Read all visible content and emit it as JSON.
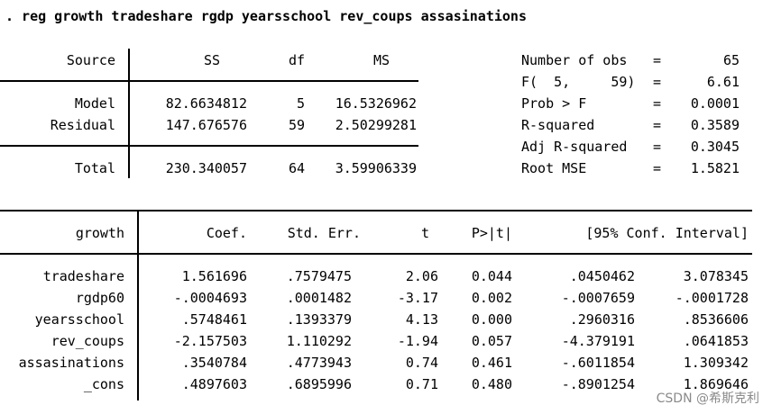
{
  "command": ". reg growth tradeshare rgdp yearsschool rev_coups assasinations",
  "anova": {
    "headers": {
      "source": "Source",
      "ss": "SS",
      "df": "df",
      "ms": "MS"
    },
    "rows": [
      {
        "source": "Model",
        "ss": "82.6634812",
        "df": "5",
        "ms": "16.5326962"
      },
      {
        "source": "Residual",
        "ss": "147.676576",
        "df": "59",
        "ms": "2.50299281"
      },
      {
        "source": "Total",
        "ss": "230.340057",
        "df": "64",
        "ms": "3.59906339"
      }
    ]
  },
  "stats": [
    {
      "label": "Number of obs",
      "eq": "=",
      "value": "65"
    },
    {
      "label": "F(  5,     59)",
      "eq": "=",
      "value": "6.61"
    },
    {
      "label": "Prob > F",
      "eq": "=",
      "value": "0.0001"
    },
    {
      "label": "R-squared",
      "eq": "=",
      "value": "0.3589"
    },
    {
      "label": "Adj R-squared",
      "eq": "=",
      "value": "0.3045"
    },
    {
      "label": "Root MSE",
      "eq": "=",
      "value": "1.5821"
    }
  ],
  "coef": {
    "headers": {
      "var": "growth",
      "coef": "Coef.",
      "se": "Std. Err.",
      "t": "t",
      "p": "P>|t|",
      "ci": "[95% Conf. Interval]"
    },
    "rows": [
      {
        "var": "tradeshare",
        "coef": "1.561696",
        "se": ".7579475",
        "t": "2.06",
        "p": "0.044",
        "lo": ".0450462",
        "hi": "3.078345"
      },
      {
        "var": "rgdp60",
        "coef": "-.0004693",
        "se": ".0001482",
        "t": "-3.17",
        "p": "0.002",
        "lo": "-.0007659",
        "hi": "-.0001728"
      },
      {
        "var": "yearsschool",
        "coef": ".5748461",
        "se": ".1393379",
        "t": "4.13",
        "p": "0.000",
        "lo": ".2960316",
        "hi": ".8536606"
      },
      {
        "var": "rev_coups",
        "coef": "-2.157503",
        "se": "1.110292",
        "t": "-1.94",
        "p": "0.057",
        "lo": "-4.379191",
        "hi": ".0641853"
      },
      {
        "var": "assasinations",
        "coef": ".3540784",
        "se": ".4773943",
        "t": "0.74",
        "p": "0.461",
        "lo": "-.6011854",
        "hi": "1.309342"
      },
      {
        "var": "_cons",
        "coef": ".4897603",
        "se": ".6895996",
        "t": "0.71",
        "p": "0.480",
        "lo": "-.8901254",
        "hi": "1.869646"
      }
    ]
  },
  "watermark": "CSDN @希斯克利"
}
